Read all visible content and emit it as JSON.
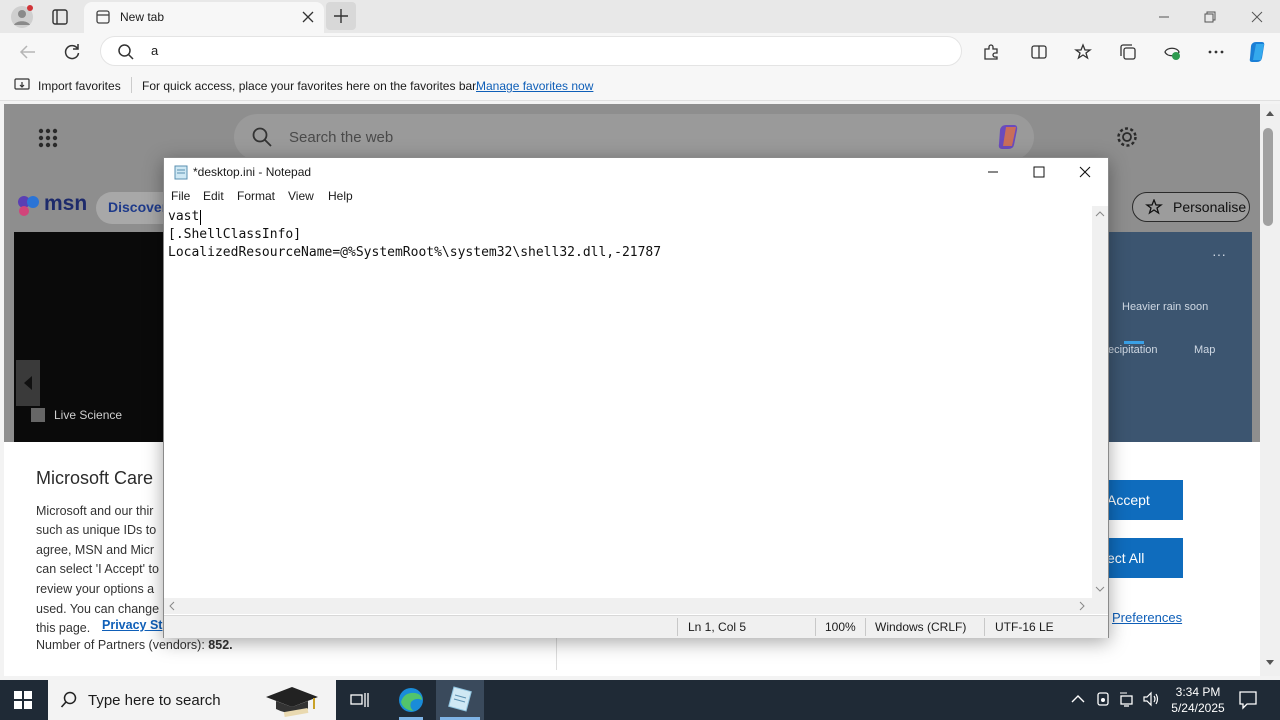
{
  "browser": {
    "tab_title": "New tab",
    "address_value": "a",
    "favorites_bar": {
      "import_label": "Import favorites",
      "message": "For quick access, place your favorites here on the favorites bar.",
      "manage_link": "Manage favorites now"
    }
  },
  "msn": {
    "search_placeholder": "Search the web",
    "logo_text": "msn",
    "discover_label": "Discover",
    "personalise_label": "Personalise",
    "news_source": "Live Science",
    "weather": {
      "rain_label": "Heavier rain soon",
      "precip_tab": "ecipitation",
      "map_tab": "Map"
    }
  },
  "cookie_banner": {
    "title": "Microsoft Care",
    "lines": [
      "Microsoft and our thir",
      "such as unique IDs to",
      "agree, MSN and Micr",
      "can select 'I Accept' to",
      "review your options a",
      "used.  You can change",
      "this page."
    ],
    "privacy_link": "Privacy St",
    "partners_label": "Number of Partners (vendors):",
    "partners_count": "852.",
    "accept_label": "Accept",
    "reject_label": "ect All",
    "preferences_label": "Preferences"
  },
  "notepad": {
    "title": "*desktop.ini - Notepad",
    "menu": [
      "File",
      "Edit",
      "Format",
      "View",
      "Help"
    ],
    "content_lines": [
      "vast",
      "[.ShellClassInfo]",
      "LocalizedResourceName=@%SystemRoot%\\system32\\shell32.dll,-21787"
    ],
    "status": {
      "position": "Ln 1, Col 5",
      "zoom": "100%",
      "line_ending": "Windows (CRLF)",
      "encoding": "UTF-16 LE"
    }
  },
  "taskbar": {
    "search_placeholder": "Type here to search",
    "time": "3:34 PM",
    "date": "5/24/2025"
  }
}
